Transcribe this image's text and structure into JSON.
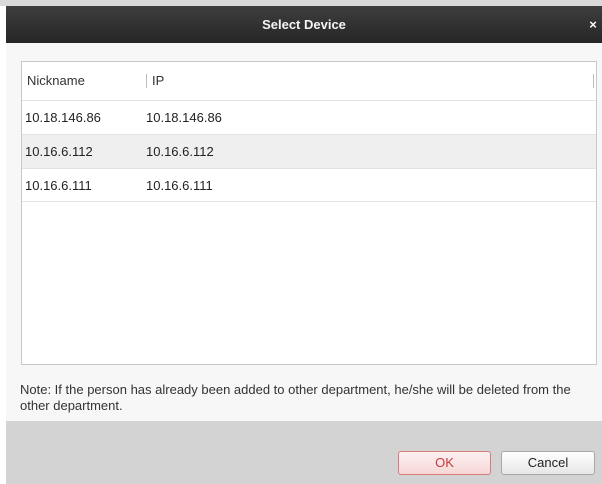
{
  "dialog": {
    "title": "Select Device",
    "close_glyph": "×",
    "close_icon": "close-icon"
  },
  "table": {
    "columns": [
      "Nickname",
      "IP"
    ],
    "rows": [
      {
        "nickname": "10.18.146.86",
        "ip": "10.18.146.86"
      },
      {
        "nickname": "10.16.6.112",
        "ip": "10.16.6.112"
      },
      {
        "nickname": "10.16.6.111",
        "ip": "10.16.6.111"
      }
    ]
  },
  "note": "Note: If the person has already been added to other department, he/she will be deleted from the other department.",
  "buttons": {
    "ok": "OK",
    "cancel": "Cancel"
  },
  "colors": {
    "titlebar": "#2e2e2e",
    "ok_text": "#c43c3c",
    "footer": "#d3d3d3"
  }
}
